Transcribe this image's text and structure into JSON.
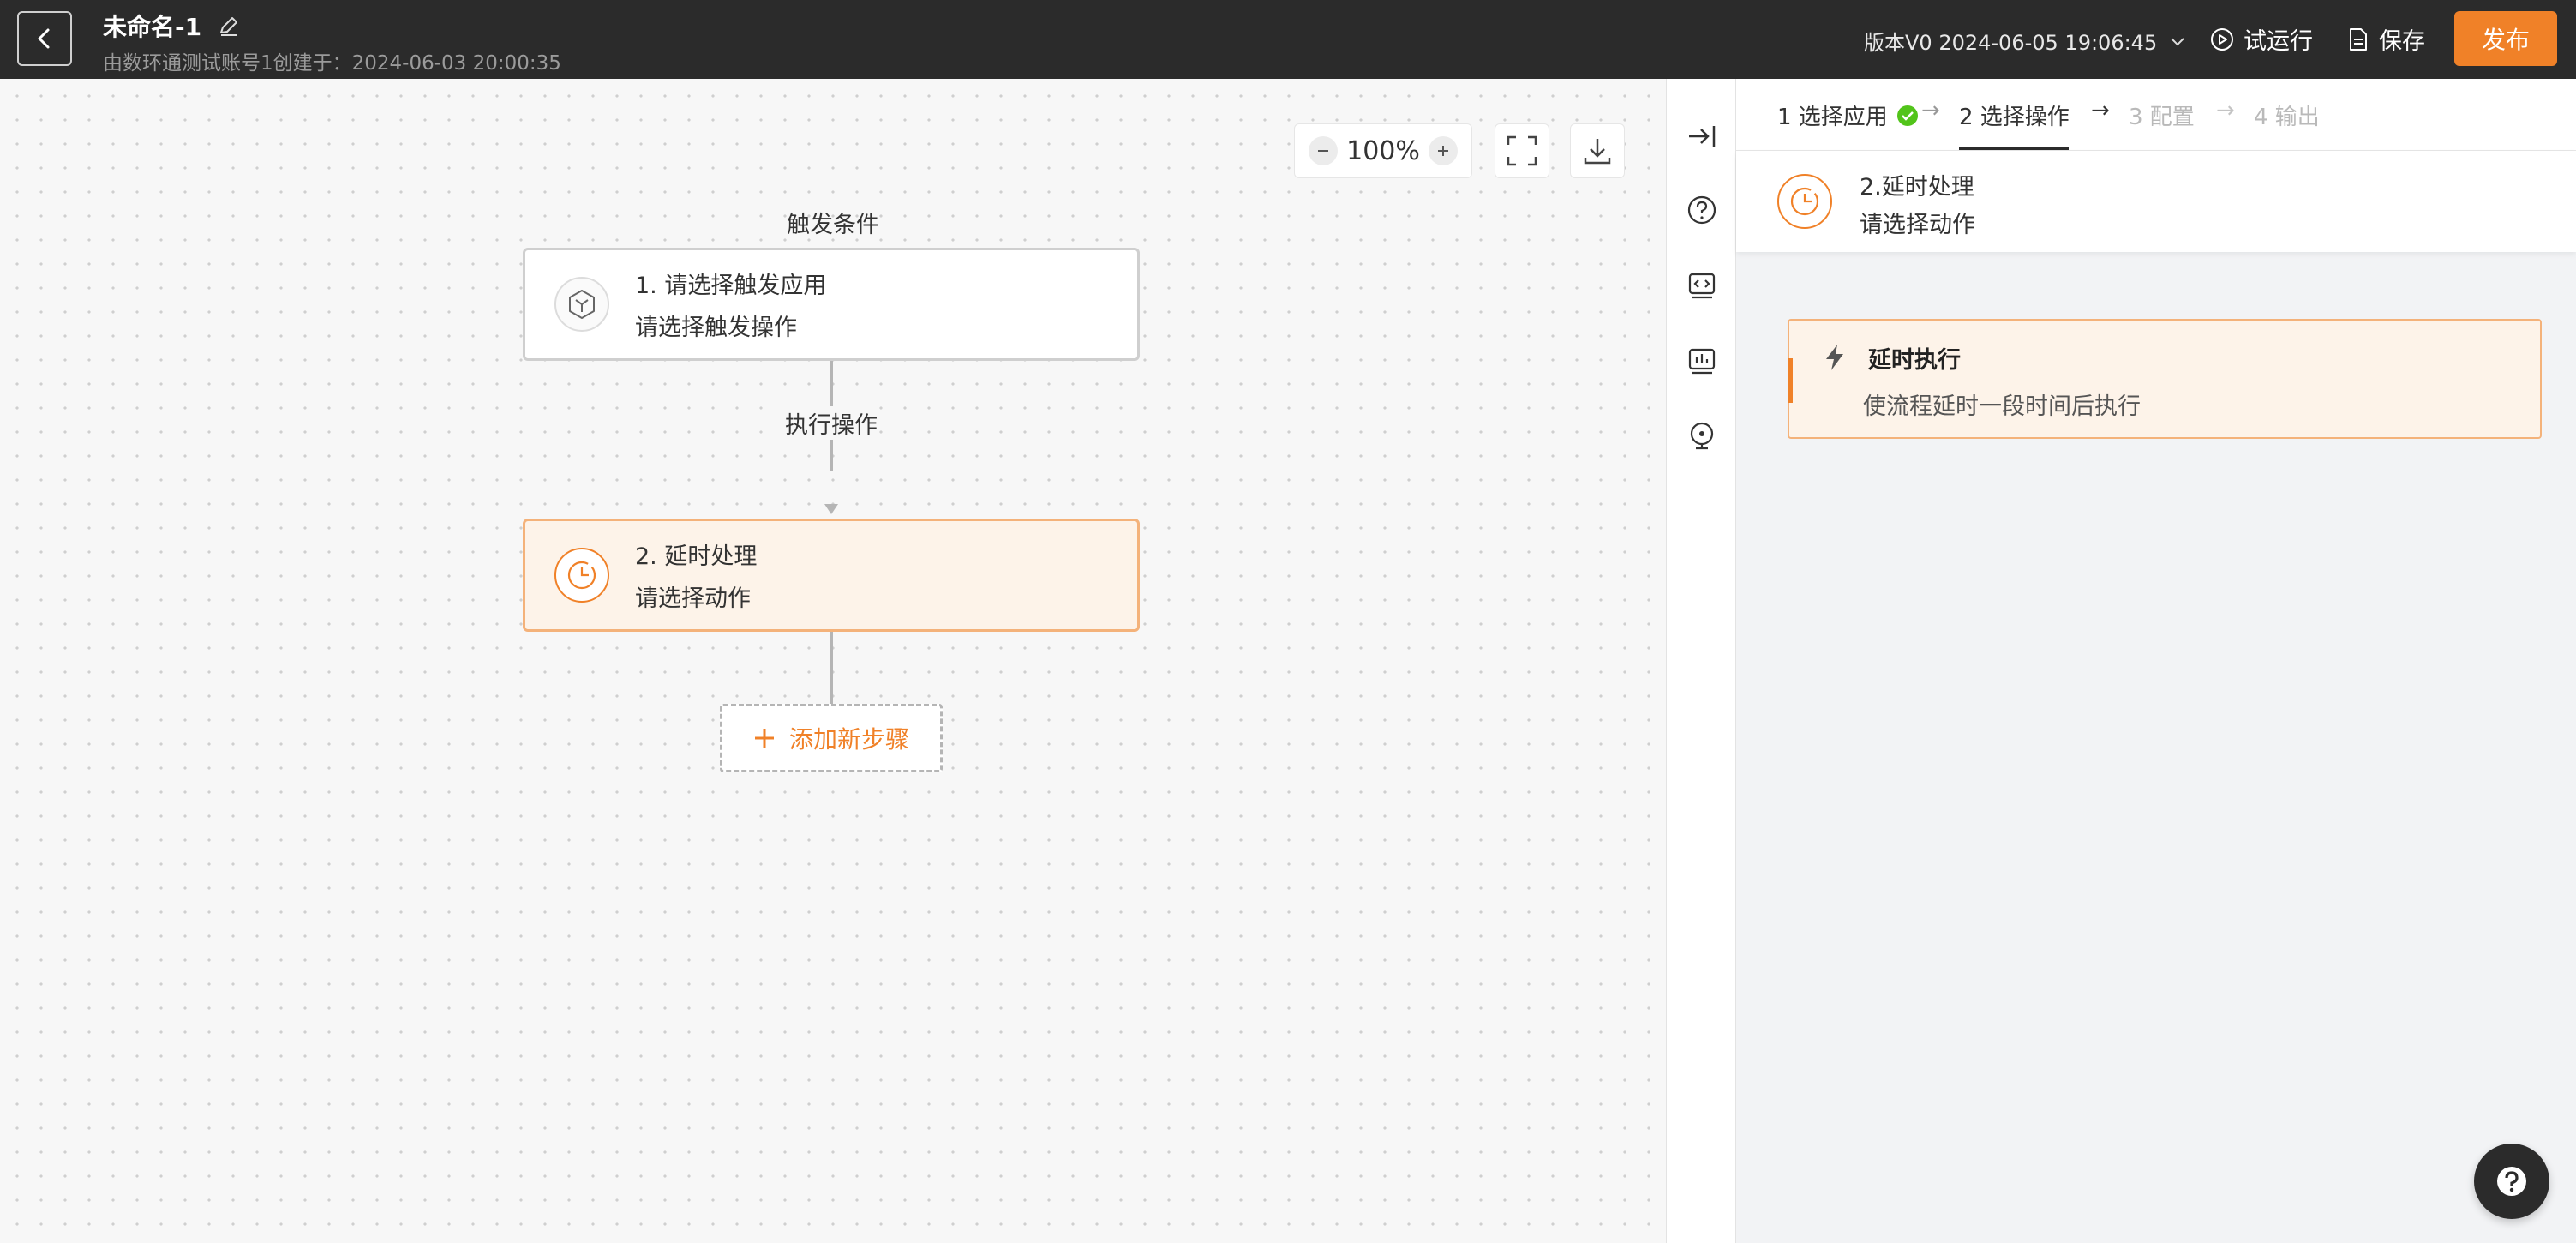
{
  "header": {
    "title": "未命名-1",
    "subtitle": "由数环通测试账号1创建于：2024-06-03 20:00:35",
    "version": "版本V0 2024-06-05 19:06:45",
    "test_run": "试运行",
    "save": "保存",
    "publish": "发布"
  },
  "canvas": {
    "zoom": "100%",
    "trigger_section": "触发条件",
    "action_section": "执行操作",
    "trigger_node": {
      "title": "1. 请选择触发应用",
      "subtitle": "请选择触发操作"
    },
    "delay_node": {
      "title": "2. 延时处理",
      "subtitle": "请选择动作"
    },
    "add_step": "添加新步骤"
  },
  "panel": {
    "steps": [
      {
        "label": "1 选择应用",
        "state": "done"
      },
      {
        "label": "2 选择操作",
        "state": "active"
      },
      {
        "label": "3 配置",
        "state": "pending"
      },
      {
        "label": "4 输出",
        "state": "pending"
      }
    ],
    "summary": {
      "title": "2.延时处理",
      "subtitle": "请选择动作"
    },
    "option": {
      "title": "延时执行",
      "description": "使流程延时一段时间后执行"
    }
  },
  "colors": {
    "accent": "#f08128",
    "header_bg": "#2b2b2b",
    "success": "#52c41a"
  }
}
